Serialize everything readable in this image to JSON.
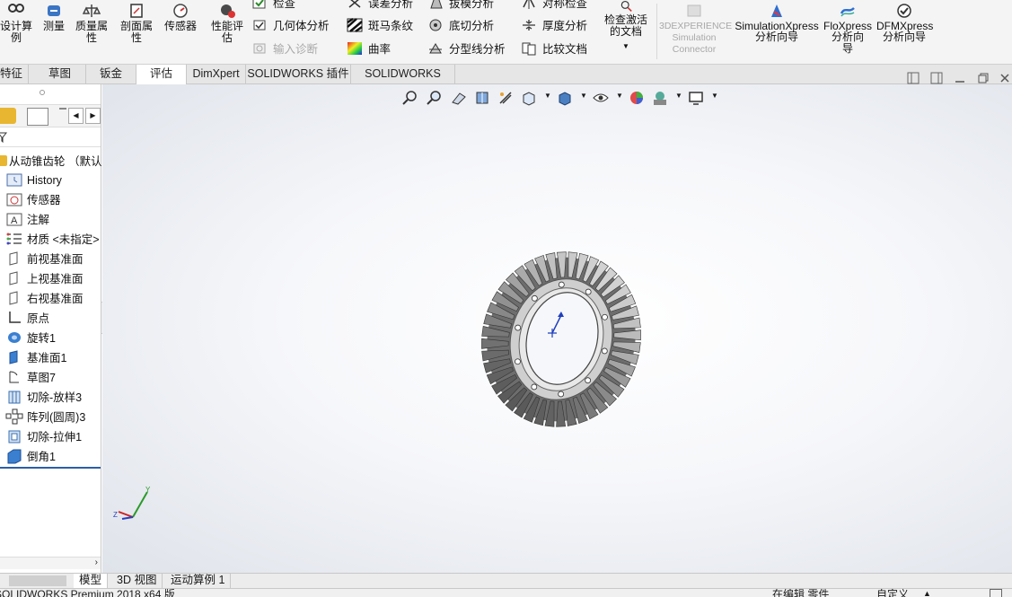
{
  "ribbon": {
    "design_study": "设计算例",
    "measure": "测量",
    "mass_props": "质量属性",
    "section_props": "剖面属性",
    "sensor": "传感器",
    "perf_eval": "性能评估",
    "check": "检查",
    "geometry_analysis": "几何体分析",
    "import_diag": "输入诊断",
    "deviation": "误差分析",
    "zebra": "斑马条纹",
    "curvature": "曲率",
    "draft": "拔模分析",
    "undercut": "底切分析",
    "parting": "分型线分析",
    "symmetry": "对称检查",
    "thickness": "厚度分析",
    "compare": "比较文档",
    "check_active": "检查激活的文档",
    "threedx": "3DEXPERIENCE Simulation Connector",
    "simxpress_1": "SimulationXpress",
    "simxpress_2": "分析向导",
    "floxpress_1": "FloXpress",
    "floxpress_2": "分析向导",
    "dfmxpress_1": "DFMXpress",
    "dfmxpress_2": "分析向导"
  },
  "tabs": [
    "特征",
    "草图",
    "钣金",
    "评估",
    "DimXpert",
    "SOLIDWORKS 插件",
    "SOLIDWORKS MBD"
  ],
  "tree": {
    "root": "从动锥齿轮 （默认<",
    "items": [
      "History",
      "传感器",
      "注解",
      "材质 <未指定>",
      "前视基准面",
      "上视基准面",
      "右视基准面",
      "原点",
      "旋转1",
      "基准面1",
      "草图7",
      "切除-放样3",
      "阵列(圆周)3",
      "切除-拉伸1",
      "倒角1"
    ]
  },
  "bottom_tabs": [
    "模型",
    "3D 视图",
    "运动算例 1"
  ],
  "status": {
    "app": "SOLIDWORKS Premium 2018 x64 版",
    "editing": "在编辑 零件",
    "custom": "自定义"
  },
  "colors": {
    "accent": "#1e5fbf",
    "gear": "#8e8e8e"
  }
}
